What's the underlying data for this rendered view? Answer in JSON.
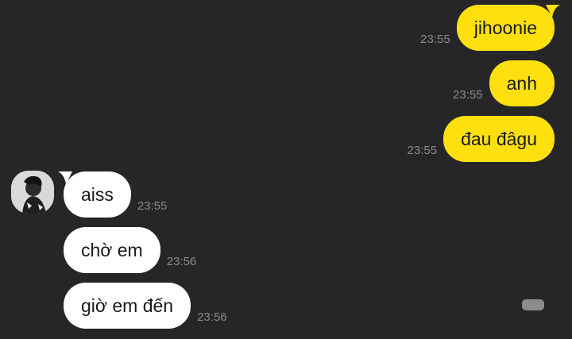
{
  "messages": [
    {
      "direction": "out",
      "text": "jihoonie",
      "time": "23:55"
    },
    {
      "direction": "out",
      "text": "anh",
      "time": "23:55"
    },
    {
      "direction": "out",
      "text": "đau đâgu",
      "time": "23:55"
    },
    {
      "direction": "in",
      "text": "aiss",
      "time": "23:55"
    },
    {
      "direction": "in",
      "text": "chờ em",
      "time": "23:56"
    },
    {
      "direction": "in",
      "text": "giờ em đến",
      "time": "23:56"
    }
  ],
  "colors": {
    "background": "#262628",
    "outgoing_bubble": "#FFE00F",
    "incoming_bubble": "#FFFFFF",
    "timestamp": "#8a8a8c"
  },
  "icons": {
    "avatar": "contact-avatar-photo",
    "scroll": "scroll-handle"
  }
}
